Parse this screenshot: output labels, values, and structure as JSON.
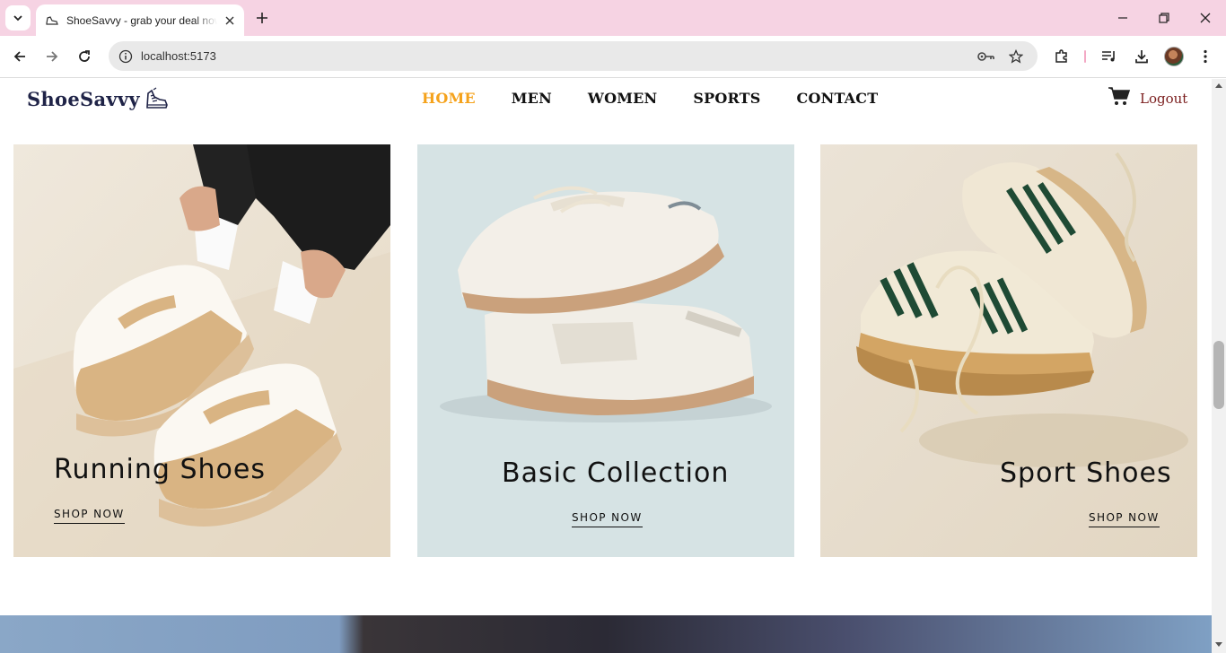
{
  "browser": {
    "tab_title": "ShoeSavvy - grab your deal now",
    "url": "localhost:5173"
  },
  "site": {
    "logo_text": "ShoeSavvy",
    "nav": [
      {
        "label": "HOME",
        "active": true
      },
      {
        "label": "MEN",
        "active": false
      },
      {
        "label": "WOMEN",
        "active": false
      },
      {
        "label": "SPORTS",
        "active": false
      },
      {
        "label": "CONTACT",
        "active": false
      }
    ],
    "logout_label": "Logout"
  },
  "cards": [
    {
      "title": "Running Shoes",
      "cta": "SHOP NOW"
    },
    {
      "title": "Basic Collection",
      "cta": "SHOP NOW"
    },
    {
      "title": "Sport Shoes",
      "cta": "SHOP NOW"
    }
  ],
  "colors": {
    "tab_strip": "#f6d3e3",
    "nav_active": "#f5a21b",
    "logo": "#1f2347",
    "logout": "#7a1d1d",
    "card2_bg": "#d6e3e4"
  }
}
